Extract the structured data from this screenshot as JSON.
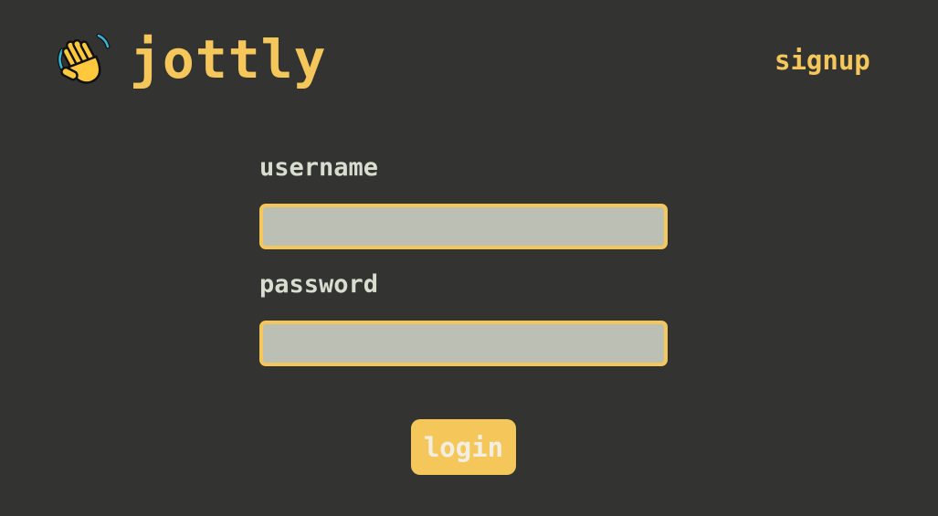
{
  "app": {
    "brand": "jottly",
    "logo_icon": "waving-hand-icon"
  },
  "nav": {
    "signup_label": "signup"
  },
  "login_form": {
    "username_label": "username",
    "username_value": "",
    "username_placeholder": "",
    "password_label": "password",
    "password_value": "",
    "password_placeholder": "",
    "submit_label": "login"
  },
  "colors": {
    "background": "#333432",
    "accent": "#f5c75b",
    "label_text": "#d8ddd0",
    "input_fill": "#bcbfb4",
    "button_text": "#f2efe2"
  }
}
